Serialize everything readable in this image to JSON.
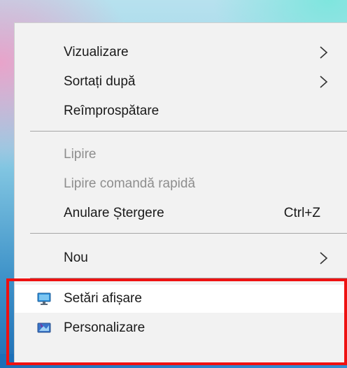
{
  "menu": {
    "view": "Vizualizare",
    "sort_by": "Sortați după",
    "refresh": "Reîmprospătare",
    "paste": "Lipire",
    "paste_shortcut": "Lipire comandă rapidă",
    "undo_delete": "Anulare Ștergere",
    "undo_shortcut_key": "Ctrl+Z",
    "new": "Nou",
    "display_settings": "Setări afișare",
    "personalize": "Personalizare"
  },
  "colors": {
    "menu_background": "#f2f2f2",
    "highlight_border": "#ee1111",
    "disabled_text": "#8e8e8e"
  }
}
